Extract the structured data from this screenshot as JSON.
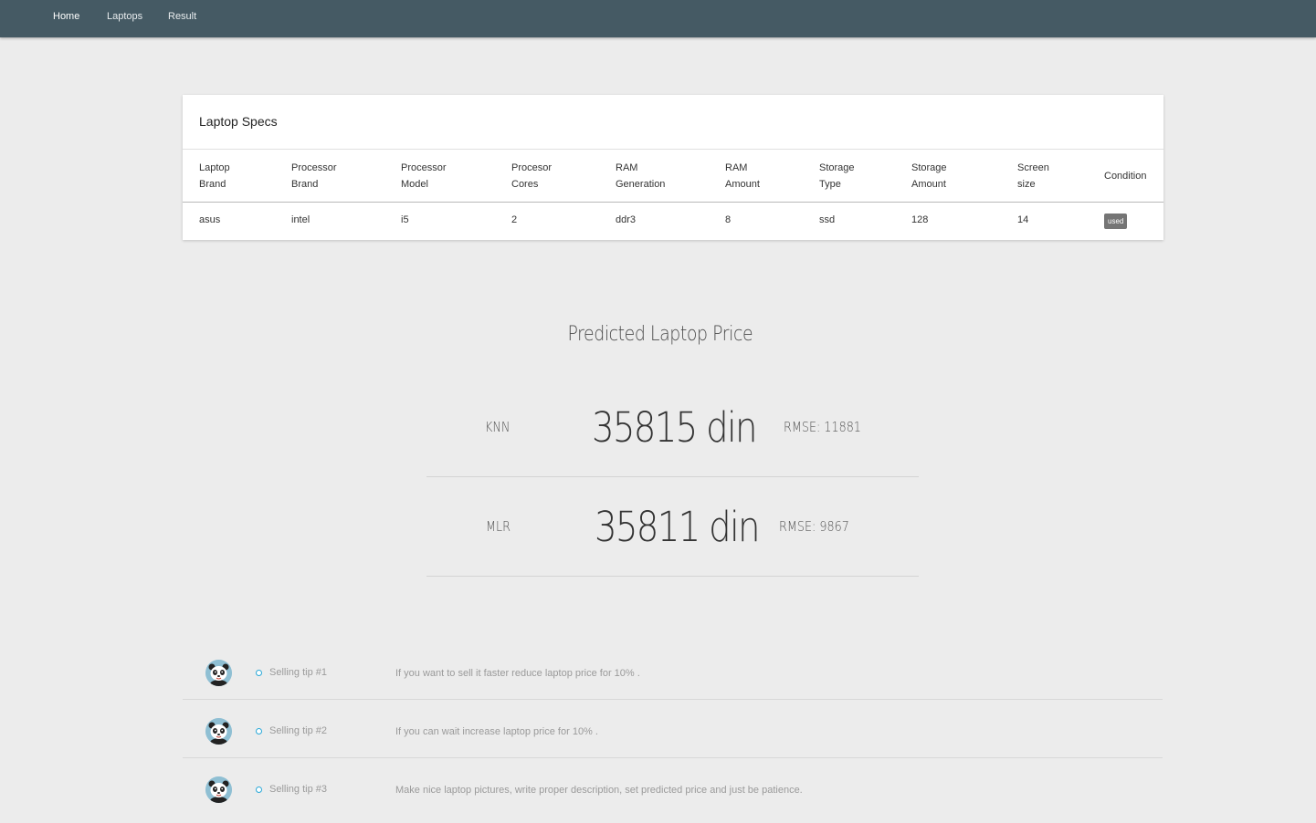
{
  "nav": {
    "home": "Home",
    "laptops": "Laptops",
    "result": "Result"
  },
  "specs": {
    "title": "Laptop Specs",
    "headers": [
      [
        "Laptop",
        "Brand"
      ],
      [
        "Processor",
        "Brand"
      ],
      [
        "Processor",
        "Model"
      ],
      [
        "Procesor",
        "Cores"
      ],
      [
        "RAM",
        "Generation"
      ],
      [
        "RAM",
        "Amount"
      ],
      [
        "Storage",
        "Type"
      ],
      [
        "Storage",
        "Amount"
      ],
      [
        "Screen",
        "size"
      ],
      [
        "Condition"
      ]
    ],
    "row": [
      "asus",
      "intel",
      "i5",
      "2",
      "ddr3",
      "8",
      "ssd",
      "128",
      "14"
    ],
    "condition_badge": "used"
  },
  "prediction": {
    "title": "Predicted Laptop Price",
    "rows": [
      {
        "algorithm": "KNN",
        "price": "35815 din",
        "rmse": "RMSE: 11881"
      },
      {
        "algorithm": "MLR",
        "price": "35811 din",
        "rmse": "RMSE: 9867"
      }
    ]
  },
  "tips": [
    {
      "label": "Selling tip #1",
      "text": "If you want to sell it faster reduce laptop price for 10% ."
    },
    {
      "label": "Selling tip #2",
      "text": "If you can wait increase laptop price for 10% ."
    },
    {
      "label": "Selling tip #3",
      "text": "Make nice laptop pictures, write proper description, set predicted price and just be patience."
    }
  ],
  "colors": {
    "navbar": "#455a64",
    "background": "#ececec",
    "badge": "#757575",
    "tip_circle": "#29a8d8"
  },
  "icons": {
    "avatar": "panda-avatar-icon",
    "bullet": "circle-icon"
  }
}
